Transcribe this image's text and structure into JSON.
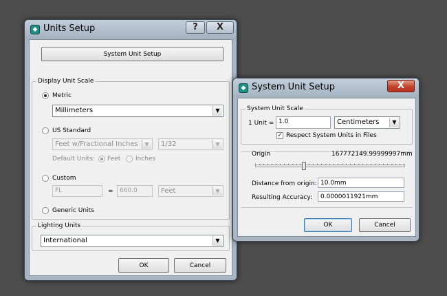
{
  "units_setup": {
    "title": "Units Setup",
    "help_glyph": "?",
    "close_glyph": "X",
    "system_unit_setup_button": "System Unit Setup",
    "display_unit_scale": {
      "legend": "Display Unit Scale",
      "metric_label": "Metric",
      "metric_value": "Millimeters",
      "us_standard_label": "US Standard",
      "us_value": "Feet w/Fractional Inches",
      "us_fraction": "1/32",
      "default_units_label": "Default Units:",
      "feet_label": "Feet",
      "inches_label": "Inches",
      "custom_label": "Custom",
      "custom_name": "FL",
      "equals": "=",
      "custom_value": "660.0",
      "custom_unit": "Feet",
      "generic_label": "Generic Units"
    },
    "lighting_units": {
      "legend": "Lighting Units",
      "value": "International"
    },
    "ok_label": "OK",
    "cancel_label": "Cancel"
  },
  "system_unit_setup": {
    "title": "System Unit Setup",
    "close_glyph": "X",
    "system_unit_scale": {
      "legend": "System Unit Scale",
      "unit_label": "1 Unit =",
      "unit_value": "1.0",
      "unit_type": "Centimeters",
      "respect_label": "Respect System Units in Files",
      "respect_checked": true
    },
    "origin_label": "Origin",
    "origin_value": "167772149.99999997mm",
    "distance_label": "Distance from origin:",
    "distance_value": "10.0mm",
    "accuracy_label": "Resulting Accuracy:",
    "accuracy_value": "0.0000011921mm",
    "ok_label": "OK",
    "cancel_label": "Cancel"
  },
  "icons": {
    "app_icon": "3ds-max-icon",
    "dropdown_arrow": "▼",
    "check_mark": "✓"
  }
}
